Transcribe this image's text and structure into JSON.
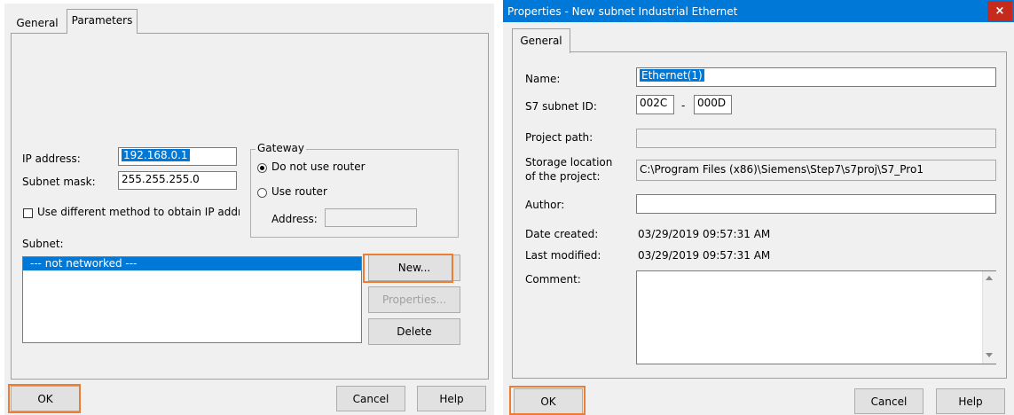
{
  "left": {
    "tabs": [
      {
        "label": "General"
      },
      {
        "label": "Parameters"
      }
    ],
    "ip_label": "IP address:",
    "ip_value": "192.168.0.1",
    "mask_label": "Subnet mask:",
    "mask_value": "255.255.255.0",
    "gateway": {
      "title": "Gateway",
      "no_router": "Do not use router",
      "use_router": "Use router",
      "address_label": "Address:",
      "address_value": ""
    },
    "diff_method": "Use different method to obtain IP addres",
    "subnet_label": "Subnet:",
    "subnet_items": [
      "--- not networked ---"
    ],
    "new_btn": "New...",
    "props_btn": "Properties...",
    "delete_btn": "Delete",
    "ok": "OK",
    "cancel": "Cancel",
    "help": "Help"
  },
  "right": {
    "title": "Properties -  New subnet Industrial Ethernet",
    "close_icon": "close-icon",
    "tab": "General",
    "name_label": "Name:",
    "name_value": "Ethernet(1)",
    "subnet_id_label": "S7 subnet ID:",
    "subnet_id_1": "002C",
    "subnet_id_sep": "-",
    "subnet_id_2": "000D",
    "project_path_label": "Project path:",
    "project_path_value": "",
    "storage_label_1": "Storage location",
    "storage_label_2": "of the project:",
    "storage_value": "C:\\Program Files (x86)\\Siemens\\Step7\\s7proj\\S7_Pro1",
    "author_label": "Author:",
    "author_value": "",
    "created_label": "Date created:",
    "created_value": "03/29/2019 09:57:31 AM",
    "modified_label": "Last modified:",
    "modified_value": "03/29/2019 09:57:31 AM",
    "comment_label": "Comment:",
    "comment_value": "",
    "ok": "OK",
    "cancel": "Cancel",
    "help": "Help"
  },
  "colors": {
    "highlight": "#ed7d31",
    "titlebar": "#0078d7",
    "close": "#c42b1c",
    "selection": "#0078d7"
  }
}
